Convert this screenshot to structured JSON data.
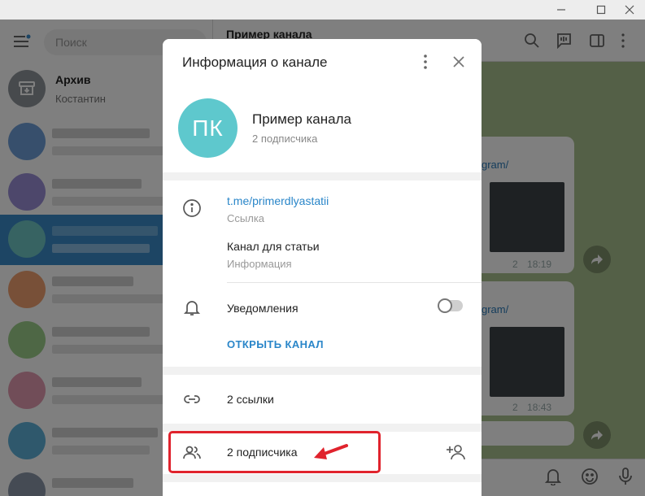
{
  "search": {
    "placeholder": "Поиск"
  },
  "archive": {
    "title": "Архив",
    "subtitle": "Костантин"
  },
  "chat": {
    "title": "Пример канала",
    "link_suffix": "gram/",
    "views": "2",
    "time1": "18:19",
    "time2": "18:43"
  },
  "modal": {
    "title": "Информация о канале",
    "channel": {
      "initials": "ПК",
      "name": "Пример канала",
      "subscribers": "2 подписчика"
    },
    "link": {
      "value": "t.me/primerdlyastatii",
      "label": "Ссылка"
    },
    "description": {
      "value": "Канал для статьи",
      "label": "Информация"
    },
    "notifications": {
      "label": "Уведомления",
      "enabled": false
    },
    "open_channel": "ОТКРЫТЬ КАНАЛ",
    "links": "2 ссылки",
    "members": "2 подписчика"
  },
  "colors": {
    "accent": "#2a86c9",
    "avatar": "#5ec8cd",
    "highlight": "#e0232d",
    "chat_bg": "#a9c18f"
  }
}
